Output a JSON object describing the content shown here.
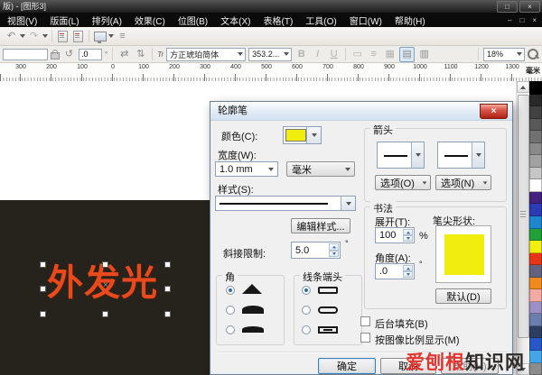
{
  "titlebar": {
    "title": "版) - [图形3]"
  },
  "window_controls": {
    "restore": "□",
    "close": "×",
    "doc_minimize": "–",
    "doc_restore": "□",
    "doc_close": "×"
  },
  "menubar": {
    "items": [
      "视图(V)",
      "版面(L)",
      "排列(A)",
      "效果(C)",
      "位图(B)",
      "文本(X)",
      "表格(T)",
      "工具(O)",
      "窗口(W)",
      "帮助(H)"
    ]
  },
  "icons": {
    "undo": "↶",
    "redo": "↷",
    "rotate": "↺",
    "mirror_horizontal": "⇄",
    "mirror_vertical": "⇅",
    "bullet_list": "≡",
    "font_type": "Tr",
    "text_frame": "▭",
    "drop_cap": "▦",
    "horizontal_text": "▤",
    "vertical_text": "▥",
    "rotation_center": "×"
  },
  "propbar": {
    "rotation_value": ".0",
    "degree": "°",
    "font_name": "方正琥珀简体",
    "font_size": "353.2...",
    "bold": "B",
    "italic": "I",
    "underline": "U",
    "zoom_level": "18%"
  },
  "ruler": {
    "numbers": [
      "300",
      "200",
      "100",
      "0",
      "100",
      "200",
      "300",
      "400",
      "500",
      "600",
      "700",
      "800",
      "900",
      "1000",
      "1100",
      "1200",
      "1300"
    ],
    "unit": "毫米"
  },
  "canvas": {
    "object_text": "外发光",
    "object_color": "#e8491d",
    "background_dark": "#26221c"
  },
  "palette": {
    "colors": [
      "#000000",
      "#292929",
      "#414141",
      "#595959",
      "#717171",
      "#898989",
      "#a1a1a1",
      "#c6c6c6",
      "#ffffff",
      "#44217d",
      "#2a3bb4",
      "#1d86cf",
      "#1fa038",
      "#f2ee0e",
      "#e8351a",
      "#63637f",
      "#f08a1d",
      "#f2aaa2",
      "#9c8fc5",
      "#6b7fae",
      "#2d3f61",
      "#2757c8",
      "#43a5e6",
      "#8c8c8c"
    ]
  },
  "dialog": {
    "title": "轮廓笔",
    "close": "×",
    "color_label": "颜色(C):",
    "swatch_color": "#f1ee0d",
    "width_label": "宽度(W):",
    "width_value": "1.0 mm",
    "width_unit": "毫米",
    "style_label": "样式(S):",
    "edit_style_button": "编辑样式...",
    "miter_label": "斜接限制:",
    "miter_value": "5.0",
    "miter_unit": "°",
    "corner_group": "角",
    "cap_group": "线条端头",
    "arrow_group": "箭头",
    "options_o_button": "选项(O)",
    "options_n_button": "选项(N)",
    "calligraphy_group": "书法",
    "stretch_label": "展开(T):",
    "stretch_value": "100",
    "stretch_unit": "%",
    "angle_label": "角度(A):",
    "angle_value": ".0",
    "angle_unit": "°",
    "nib_label": "笔尖形状:",
    "nib_color": "#f1ee0d",
    "default_button": "默认(D)",
    "behind_fill_checkbox": "后台填充(B)",
    "scale_image_checkbox": "按图像比例显示(M)",
    "ok_button": "确定",
    "cancel_button": "取消",
    "help_button": "帮助(H)"
  },
  "watermark": {
    "red_text": "爱刨根",
    "dark_text": "知识网",
    "red_color": "#e23530",
    "dark_color": "#2f2b28"
  }
}
